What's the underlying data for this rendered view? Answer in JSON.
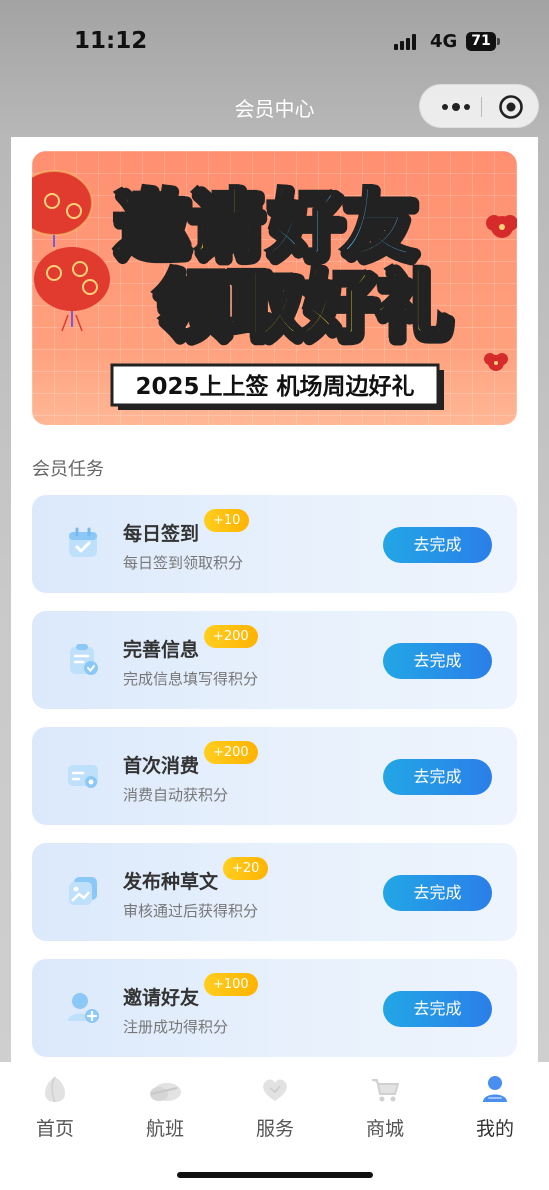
{
  "status_bar": {
    "time": "11:12",
    "network": "4G",
    "battery": "71"
  },
  "nav": {
    "title": "会员中心"
  },
  "banner": {
    "line1_a": "邀请",
    "line1_b": "好友",
    "line2": "领取好礼",
    "tagline": "2025上上签 机场周边好礼"
  },
  "section": {
    "title": "会员任务"
  },
  "tasks": [
    {
      "name": "每日签到",
      "badge": "+10",
      "desc": "每日签到领取积分",
      "button": "去完成",
      "icon": "calendar-check-icon"
    },
    {
      "name": "完善信息",
      "badge": "+200",
      "desc": "完成信息填写得积分",
      "button": "去完成",
      "icon": "clipboard-check-icon"
    },
    {
      "name": "首次消费",
      "badge": "+200",
      "desc": "消费自动获积分",
      "button": "去完成",
      "icon": "card-icon"
    },
    {
      "name": "发布种草文",
      "badge": "+20",
      "desc": "审核通过后获得积分",
      "button": "去完成",
      "icon": "image-post-icon"
    },
    {
      "name": "邀请好友",
      "badge": "+100",
      "desc": "注册成功得积分",
      "button": "去完成",
      "icon": "user-add-icon"
    }
  ],
  "tabbar": [
    {
      "label": "首页",
      "icon": "home-icon",
      "active": false
    },
    {
      "label": "航班",
      "icon": "plane-icon",
      "active": false
    },
    {
      "label": "服务",
      "icon": "heart-service-icon",
      "active": false
    },
    {
      "label": "商城",
      "icon": "cart-icon",
      "active": false
    },
    {
      "label": "我的",
      "icon": "user-icon",
      "active": true
    }
  ],
  "colors": {
    "accent": "#2b8fe8",
    "badge": "#ffc20e",
    "banner_bg": "#ff9475",
    "banner_yellow": "#ffe321",
    "banner_blue": "#54c6ff"
  }
}
